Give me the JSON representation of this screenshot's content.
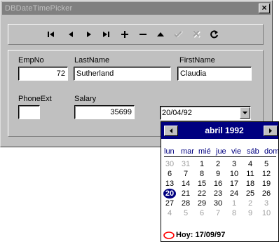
{
  "window": {
    "title": "DBDateTimePicker"
  },
  "navigator": {
    "buttons": [
      "first",
      "prior",
      "next",
      "last",
      "insert",
      "delete",
      "edit",
      "post",
      "cancel",
      "refresh"
    ]
  },
  "fields": {
    "empno": {
      "label": "EmpNo",
      "value": "72"
    },
    "lastname": {
      "label": "LastName",
      "value": "Sutherland"
    },
    "firstname": {
      "label": "FirstName",
      "value": "Claudia"
    },
    "phoneext": {
      "label": "PhoneExt",
      "value": ""
    },
    "salary": {
      "label": "Salary",
      "value": "35699"
    },
    "hiredate": {
      "value": "20/04/92"
    }
  },
  "calendar": {
    "month_label": "abril 1992",
    "weekdays": [
      "lun",
      "mar",
      "mié",
      "jue",
      "vie",
      "sáb",
      "dom"
    ],
    "weeks": [
      [
        "30",
        "31",
        "1",
        "2",
        "3",
        "4",
        "5"
      ],
      [
        "6",
        "7",
        "8",
        "9",
        "10",
        "11",
        "12"
      ],
      [
        "13",
        "14",
        "15",
        "16",
        "17",
        "18",
        "19"
      ],
      [
        "20",
        "21",
        "22",
        "23",
        "24",
        "25",
        "26"
      ],
      [
        "27",
        "28",
        "29",
        "30",
        "1",
        "2",
        "3"
      ],
      [
        "4",
        "5",
        "6",
        "7",
        "8",
        "9",
        "10"
      ]
    ],
    "selected": "20",
    "today_label": "Hoy: 17/09/97"
  },
  "colors": {
    "window_face": "#c0c0c0",
    "calendar_header": "#000080",
    "today_circle": "#ff0000",
    "disabled_text": "#a0a0a0"
  }
}
